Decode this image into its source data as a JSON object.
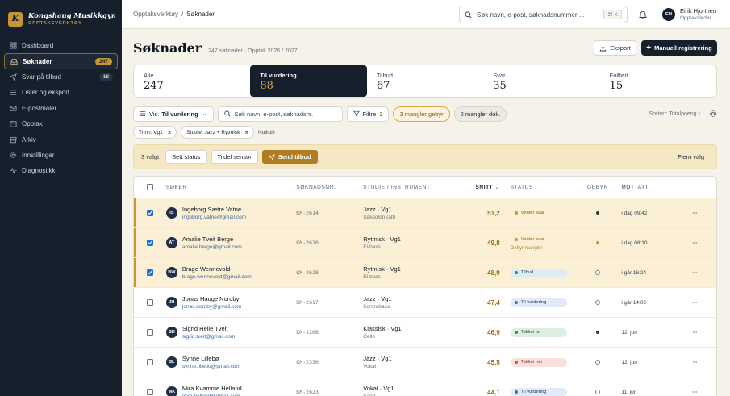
{
  "brand": {
    "logo_letter": "K",
    "name": "Kongshaug Musikkgymnas",
    "subtitle": "OPPTAKSVERKTØY"
  },
  "sidebar": {
    "items": [
      {
        "label": "Dashboard",
        "icon": "grid-icon",
        "count": ""
      },
      {
        "label": "Søknader",
        "icon": "inbox-icon",
        "count": "247",
        "active": true
      },
      {
        "label": "Svar på tilbud",
        "icon": "send-icon",
        "count": "18"
      },
      {
        "label": "Lister og eksport",
        "icon": "list-icon",
        "count": ""
      },
      {
        "label": "E-postmaler",
        "icon": "mail-icon",
        "count": ""
      },
      {
        "label": "Opptak",
        "icon": "calendar-icon",
        "count": ""
      },
      {
        "label": "Arkiv",
        "icon": "archive-icon",
        "count": ""
      },
      {
        "label": "Innstillinger",
        "icon": "gear-icon",
        "count": ""
      },
      {
        "label": "Diagnostikk",
        "icon": "pulse-icon",
        "count": ""
      }
    ]
  },
  "topbar": {
    "breadcrumb": [
      "Opptaksverktøy",
      "Søknader"
    ],
    "search_placeholder": "Søk navn, e-post, søknadsnummer ...",
    "shortcut": "⌘ K",
    "user_initials": "EH",
    "user_name": "Eirik Hjorthen",
    "user_role": "Opptaksleder"
  },
  "page": {
    "title": "Søknader",
    "subtitle": "247 søknader · Opptak 2026 / 2027",
    "export_label": "Eksport",
    "manual_label": "Manuell registrering"
  },
  "stats": [
    {
      "label": "Alle",
      "value": "247"
    },
    {
      "label": "Til vurdering",
      "value": "88",
      "active": true
    },
    {
      "label": "Tilbud",
      "value": "67"
    },
    {
      "label": "Svar",
      "value": "35"
    },
    {
      "label": "Fullført",
      "value": "15"
    }
  ],
  "filters": {
    "view_label": "Vis:",
    "view_value": "Til vurdering",
    "search_placeholder": "Søk navn, e-post, søknadsnr.",
    "filters_label": "Filtre",
    "filters_count": "2",
    "quick1": "3 mangler gebyr",
    "quick2": "2 mangler dok.",
    "sort": "Sortert: Totalpoeng ↓"
  },
  "chips": {
    "items": [
      "Trinn: Vg1",
      "Studie: Jazz + Rytmisk"
    ],
    "clear": "Nullstill"
  },
  "bulk": {
    "selected": "3 valgt",
    "set_status": "Sett status",
    "assign": "Tildel sensor",
    "send_offer": "Send tilbud",
    "clear": "Fjern valg"
  },
  "table": {
    "headers": {
      "soker": "SØKER",
      "nr": "SØKNADSNR.",
      "studie": "STUDIE / INSTRUMENT",
      "snitt": "SNITT",
      "status": "STATUS",
      "gebyr": "GEBYR",
      "mottatt": "MOTTATT"
    },
    "rows": [
      {
        "selected": true,
        "initials": "IS",
        "name": "Ingeborg Sætre Vatne",
        "email": "ingeborg.vatne@gmail.com",
        "nr": "KM-2614",
        "studie": "Jazz · Vg1",
        "instrument": "Saksofon (alt)",
        "snitt": "51,2",
        "status": "Venter svar",
        "status_type": "venter",
        "note": "",
        "gebyr": "paid",
        "mottatt": "i dag 09:42"
      },
      {
        "selected": true,
        "initials": "AT",
        "name": "Amalie Tveit Berge",
        "email": "amalie.berge@gmail.com",
        "nr": "KM-2620",
        "studie": "Rytmisk · Vg1",
        "instrument": "El-bass",
        "snitt": "49,8",
        "status": "Venter svar",
        "status_type": "venter",
        "note": "Gebyr mangler",
        "gebyr": "pend",
        "mottatt": "i dag 08:10"
      },
      {
        "selected": true,
        "initials": "BW",
        "name": "Brage Wennevold",
        "email": "brage.wennevold@gmail.com",
        "nr": "KM-2628",
        "studie": "Rytmisk · Vg1",
        "instrument": "El-bass",
        "snitt": "48,9",
        "status": "Tilbud",
        "status_type": "tilbud",
        "note": "",
        "gebyr": "none",
        "mottatt": "i går 16:24"
      },
      {
        "selected": false,
        "initials": "JH",
        "name": "Jonas Hauge Nordby",
        "email": "jonas.nordby@gmail.com",
        "nr": "KM-2617",
        "studie": "Jazz · Vg1",
        "instrument": "Kontrabass",
        "snitt": "47,4",
        "status": "Til vurdering",
        "status_type": "vurd",
        "note": "",
        "gebyr": "none",
        "mottatt": "i går 14:02"
      },
      {
        "selected": false,
        "initials": "SH",
        "name": "Sigrid Helle Tveit",
        "email": "sigrid.tveit@gmail.com",
        "nr": "KM-2208",
        "studie": "Klassisk · Vg1",
        "instrument": "Cello",
        "snitt": "46,9",
        "status": "Takket ja",
        "status_type": "takket",
        "note": "",
        "gebyr": "paid",
        "mottatt": "12. jun"
      },
      {
        "selected": false,
        "initials": "SL",
        "name": "Synne Lillebø",
        "email": "synne.lillebo@gmail.com",
        "nr": "KM-2330",
        "studie": "Jazz · Vg1",
        "instrument": "Vokal",
        "snitt": "45,5",
        "status": "Takket nei",
        "status_type": "nei",
        "note": "",
        "gebyr": "none",
        "mottatt": "12. jun"
      },
      {
        "selected": false,
        "initials": "MK",
        "name": "Mira Kvamme Helland",
        "email": "mira.helland@gmail.com",
        "nr": "KM-2623",
        "studie": "Vokal · Vg1",
        "instrument": "Sang",
        "snitt": "44,1",
        "status": "Til vurdering",
        "status_type": "vurd",
        "note": "",
        "gebyr": "none",
        "mottatt": "11. jun"
      }
    ]
  }
}
